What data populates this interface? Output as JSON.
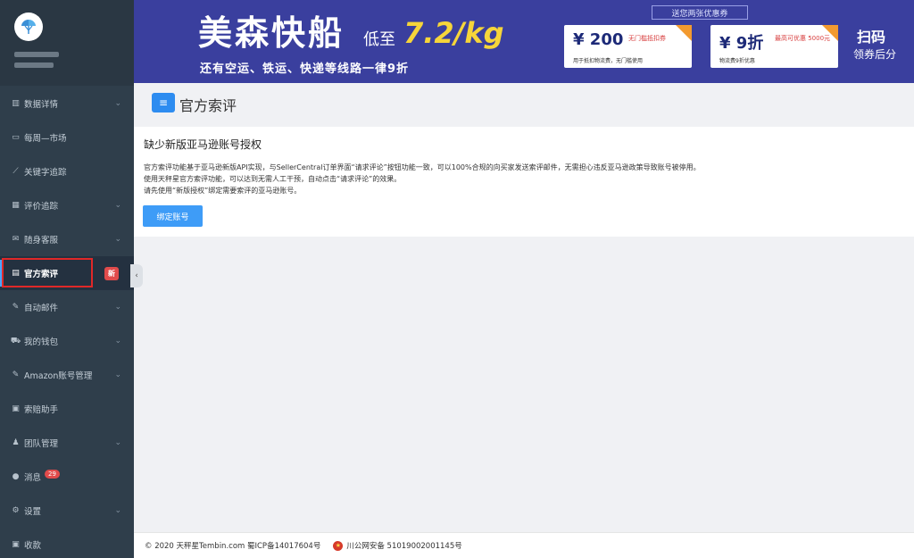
{
  "banner": {
    "title": "美森快船",
    "low": "低至",
    "price": "7.2/kg",
    "sub": "还有空运、铁运、快递等线路一律9折",
    "coupon_tag": "送您两张优惠券",
    "coupon1": {
      "main": "¥ 200",
      "side": "无门槛抵扣券",
      "foot": "用于抵扣物流费，无门槛使用"
    },
    "coupon2": {
      "main": "¥ 9折",
      "side": "最高可优惠 5000元",
      "foot": "物流费9折优惠"
    },
    "right1": "扫码",
    "right2": "领券后分"
  },
  "sidebar": {
    "items": [
      {
        "label": "数据详情",
        "icon": "bar-chart-icon"
      },
      {
        "label": "每周—市场",
        "icon": "monitor-icon"
      },
      {
        "label": "关键字追踪",
        "icon": "line-chart-icon"
      },
      {
        "label": "评价追踪",
        "icon": "table-icon"
      },
      {
        "label": "随身客服",
        "icon": "mail-icon"
      },
      {
        "label": "官方索评",
        "icon": "document-icon",
        "badge": "新"
      },
      {
        "label": "自动邮件",
        "icon": "edit-icon"
      },
      {
        "label": "我的钱包",
        "icon": "cart-icon"
      },
      {
        "label": "Amazon账号管理",
        "icon": "edit-icon"
      },
      {
        "label": "索赔助手",
        "icon": "money-icon"
      },
      {
        "label": "团队管理",
        "icon": "team-icon"
      },
      {
        "label": "消息",
        "icon": "chat-icon",
        "count": "29"
      },
      {
        "label": "设置",
        "icon": "gear-icon"
      },
      {
        "label": "收款",
        "icon": "money-icon"
      }
    ]
  },
  "page": {
    "title": "官方索评",
    "panel_title": "缺少新版亚马逊账号授权",
    "line1": "官方索评功能基于亚马逊新版API实现，与SellerCentral订单界面“请求评论”按钮功能一致，可以100%合规的向买家发送索评邮件，无需担心违反亚马逊政策导致账号被停用。",
    "line2": "使用天秤星官方索评功能，可以达到无需人工干预，自动点击“请求评论”的效果。",
    "line3": "请先使用“新版授权”绑定需要索评的亚马逊账号。",
    "bind_button": "绑定账号"
  },
  "footer": {
    "copyright": "© 2020 天秤星Tembin.com 蜀ICP备14017604号",
    "police": "川公网安备 51019002001145号"
  }
}
